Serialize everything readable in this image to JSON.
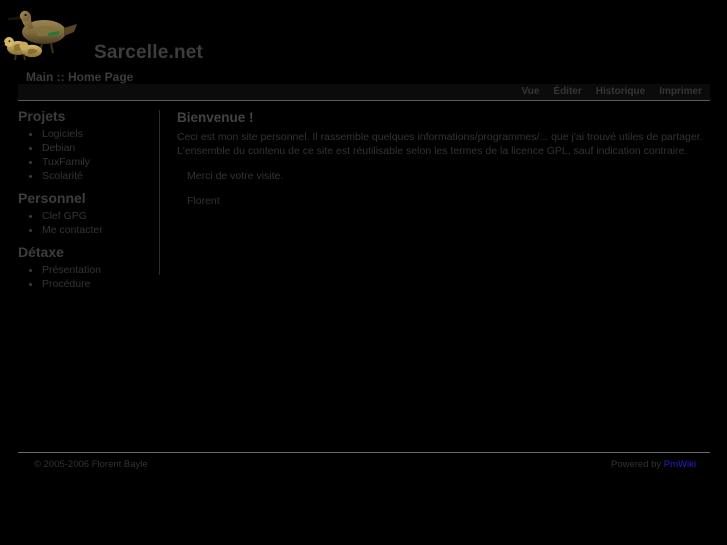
{
  "header": {
    "logo_icon": "teal-duck-logo",
    "site_title": "Sarcelle.net",
    "breadcrumb": "Main :: Home Page"
  },
  "navbar": {
    "links": [
      {
        "label": "Vue",
        "name": "nav-link-vue"
      },
      {
        "label": "Éditer",
        "name": "nav-link-editer"
      },
      {
        "label": "Historique",
        "name": "nav-link-historique"
      },
      {
        "label": "Imprimer",
        "name": "nav-link-imprimer"
      }
    ]
  },
  "sidebar": {
    "groups": [
      {
        "heading": "Projets",
        "items": [
          "Logiciels",
          "Debian",
          "TuxFamily",
          "Scolarité"
        ]
      },
      {
        "heading": "Personnel",
        "items": [
          "Clef GPG",
          "Me contacter"
        ]
      },
      {
        "heading": "Détaxe",
        "items": [
          "Présentation",
          "Procédure"
        ]
      }
    ]
  },
  "content": {
    "title": "Bienvenue !",
    "paragraph_lines": [
      "Ceci est mon site personnel. Il rassemble quelques informations/programmes/... que j'ai trouvé utiles de partager.",
      "L'ensemble du contenu de ce site est réutilisable selon les termes de la licence GPL, sauf indication contraire."
    ],
    "thanks": "Merci de votre visite.",
    "signature": "Florent"
  },
  "footer": {
    "copyright": "© 2005-2006 Florent Bayle",
    "powered_by_prefix": "Powered by ",
    "powered_by_link": "PmWiki"
  },
  "colors": {
    "page_background": "#000000",
    "text": "#333333",
    "heading": "#3d3d3d",
    "rule": "#6a6a64",
    "nav_bar_background": "#0b0b0b",
    "link": "#2222cc"
  }
}
